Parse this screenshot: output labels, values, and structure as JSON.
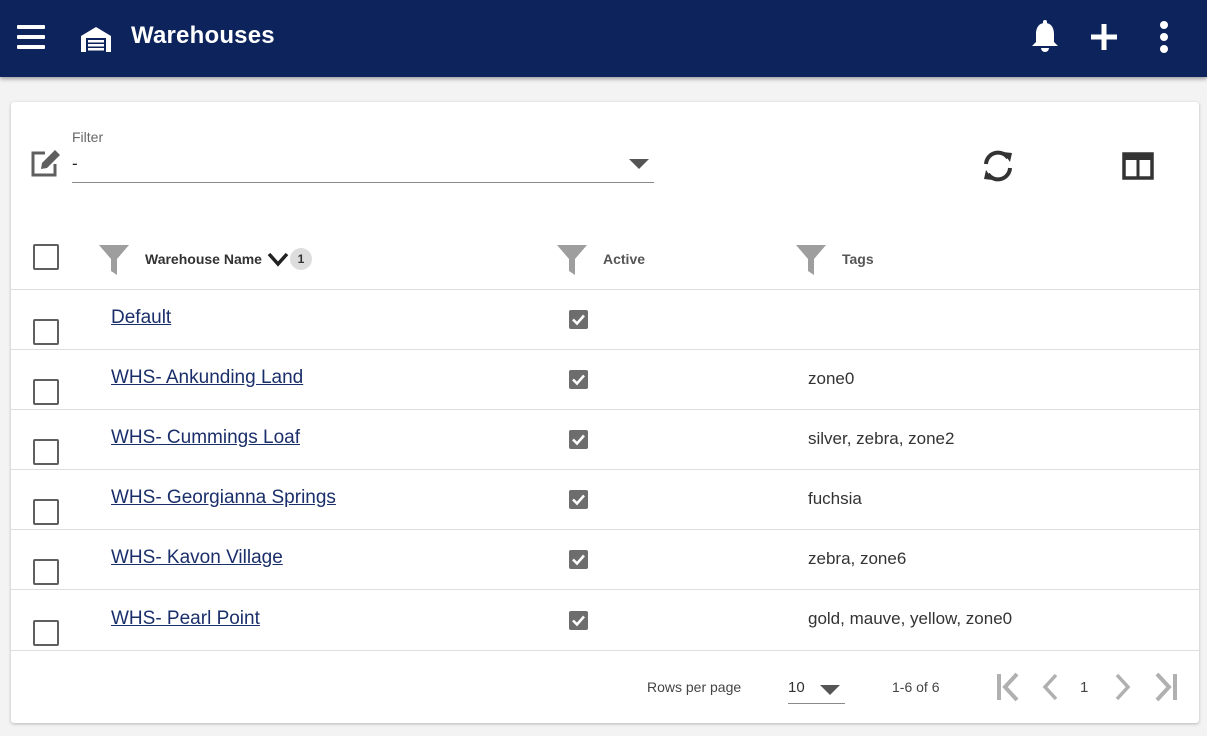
{
  "appbar": {
    "title": "Warehouses",
    "icons": [
      "menu-icon",
      "warehouse-icon",
      "bell-icon",
      "plus-icon",
      "more-vertical-icon"
    ]
  },
  "filter": {
    "label": "Filter",
    "value": "-"
  },
  "table": {
    "columns": [
      {
        "label": "Warehouse Name",
        "sort_order": "1"
      },
      {
        "label": "Active"
      },
      {
        "label": "Tags"
      }
    ],
    "rows": [
      {
        "name": "Default",
        "active": true,
        "tags": ""
      },
      {
        "name": "WHS- Ankunding Land",
        "active": true,
        "tags": "zone0"
      },
      {
        "name": "WHS- Cummings Loaf",
        "active": true,
        "tags": "silver, zebra, zone2"
      },
      {
        "name": "WHS- Georgianna Springs",
        "active": true,
        "tags": "fuchsia"
      },
      {
        "name": "WHS- Kavon Village",
        "active": true,
        "tags": "zebra, zone6"
      },
      {
        "name": "WHS- Pearl Point",
        "active": true,
        "tags": "gold, mauve, yellow, zone0"
      }
    ]
  },
  "pagination": {
    "rows_per_page_label": "Rows per page",
    "rows_per_page": "10",
    "range": "1-6 of 6",
    "page": "1"
  },
  "colors": {
    "appbar": "#0c235b",
    "link": "#1a2f6a",
    "icon_gray": "#5f5f5f"
  }
}
